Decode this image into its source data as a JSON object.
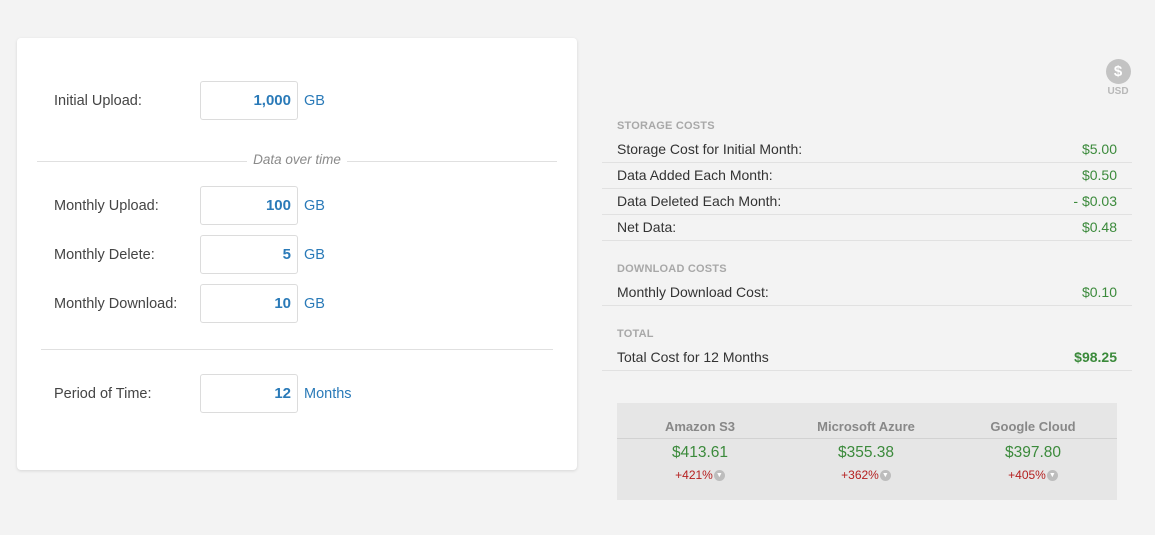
{
  "inputs": {
    "initial_upload": {
      "label": "Initial Upload:",
      "value": "1,000",
      "unit": "GB"
    },
    "section_title": "Data over time",
    "monthly_upload": {
      "label": "Monthly Upload:",
      "value": "100",
      "unit": "GB"
    },
    "monthly_delete": {
      "label": "Monthly Delete:",
      "value": "5",
      "unit": "GB"
    },
    "monthly_download": {
      "label": "Monthly Download:",
      "value": "10",
      "unit": "GB"
    },
    "period": {
      "label": "Period of Time:",
      "value": "12",
      "unit": "Months"
    }
  },
  "currency": {
    "symbol": "$",
    "code": "USD"
  },
  "storage": {
    "heading": "STORAGE COSTS",
    "rows": [
      {
        "label": "Storage Cost for Initial Month:",
        "value": "$5.00"
      },
      {
        "label": "Data Added Each Month:",
        "value": "$0.50"
      },
      {
        "label": "Data Deleted Each Month:",
        "value": "- $0.03"
      },
      {
        "label": "Net Data:",
        "value": "$0.48"
      }
    ]
  },
  "download": {
    "heading": "DOWNLOAD COSTS",
    "rows": [
      {
        "label": "Monthly Download Cost:",
        "value": "$0.10"
      }
    ]
  },
  "total": {
    "heading": "TOTAL",
    "label": "Total Cost for 12 Months",
    "value": "$98.25"
  },
  "comparison": [
    {
      "name": "Amazon S3",
      "price": "$413.61",
      "pct": "+421%"
    },
    {
      "name": "Microsoft Azure",
      "price": "$355.38",
      "pct": "+362%"
    },
    {
      "name": "Google Cloud",
      "price": "$397.80",
      "pct": "+405%"
    }
  ],
  "colors": {
    "accent_blue": "#2a7ab8",
    "price_green": "#3b8a3b",
    "pct_red": "#b52020"
  }
}
